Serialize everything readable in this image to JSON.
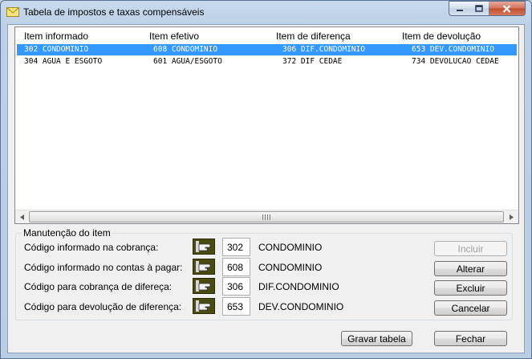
{
  "window": {
    "title": "Tabela de impostos e taxas compensáveis"
  },
  "table": {
    "columns": [
      "Item informado",
      "Item efetivo",
      "Item de diferença",
      "Item de devolução"
    ],
    "rows": [
      [
        "302 CONDOMINIO",
        "608 CONDOMINIO",
        "306 DIF.CONDOMINIO",
        "653 DEV.CONDOMINIO"
      ],
      [
        "304 AGUA E ESGOTO",
        "601 AGUA/ESGOTO",
        "372 DIF CEDAE",
        "734 DEVOLUCAO CEDAE"
      ]
    ],
    "selected_row": 0
  },
  "group": {
    "title": "Manutenção do item",
    "fields": [
      {
        "label": "Código informado na cobrança:",
        "code": "302",
        "desc": "CONDOMINIO"
      },
      {
        "label": "Código informado no contas à pagar:",
        "code": "608",
        "desc": "CONDOMINIO"
      },
      {
        "label": "Código para cobrança de difereça:",
        "code": "306",
        "desc": "DIF.CONDOMINIO"
      },
      {
        "label": "Código para devolução de diferença:",
        "code": "653",
        "desc": "DEV.CONDOMINIO"
      }
    ]
  },
  "buttons": {
    "incluir": "Incluir",
    "alterar": "Alterar",
    "excluir": "Excluir",
    "cancelar": "Cancelar",
    "gravar": "Gravar tabela",
    "fechar": "Fechar"
  },
  "colors": {
    "selection": "#3399ff",
    "icon_bg": "#4a4a14"
  }
}
